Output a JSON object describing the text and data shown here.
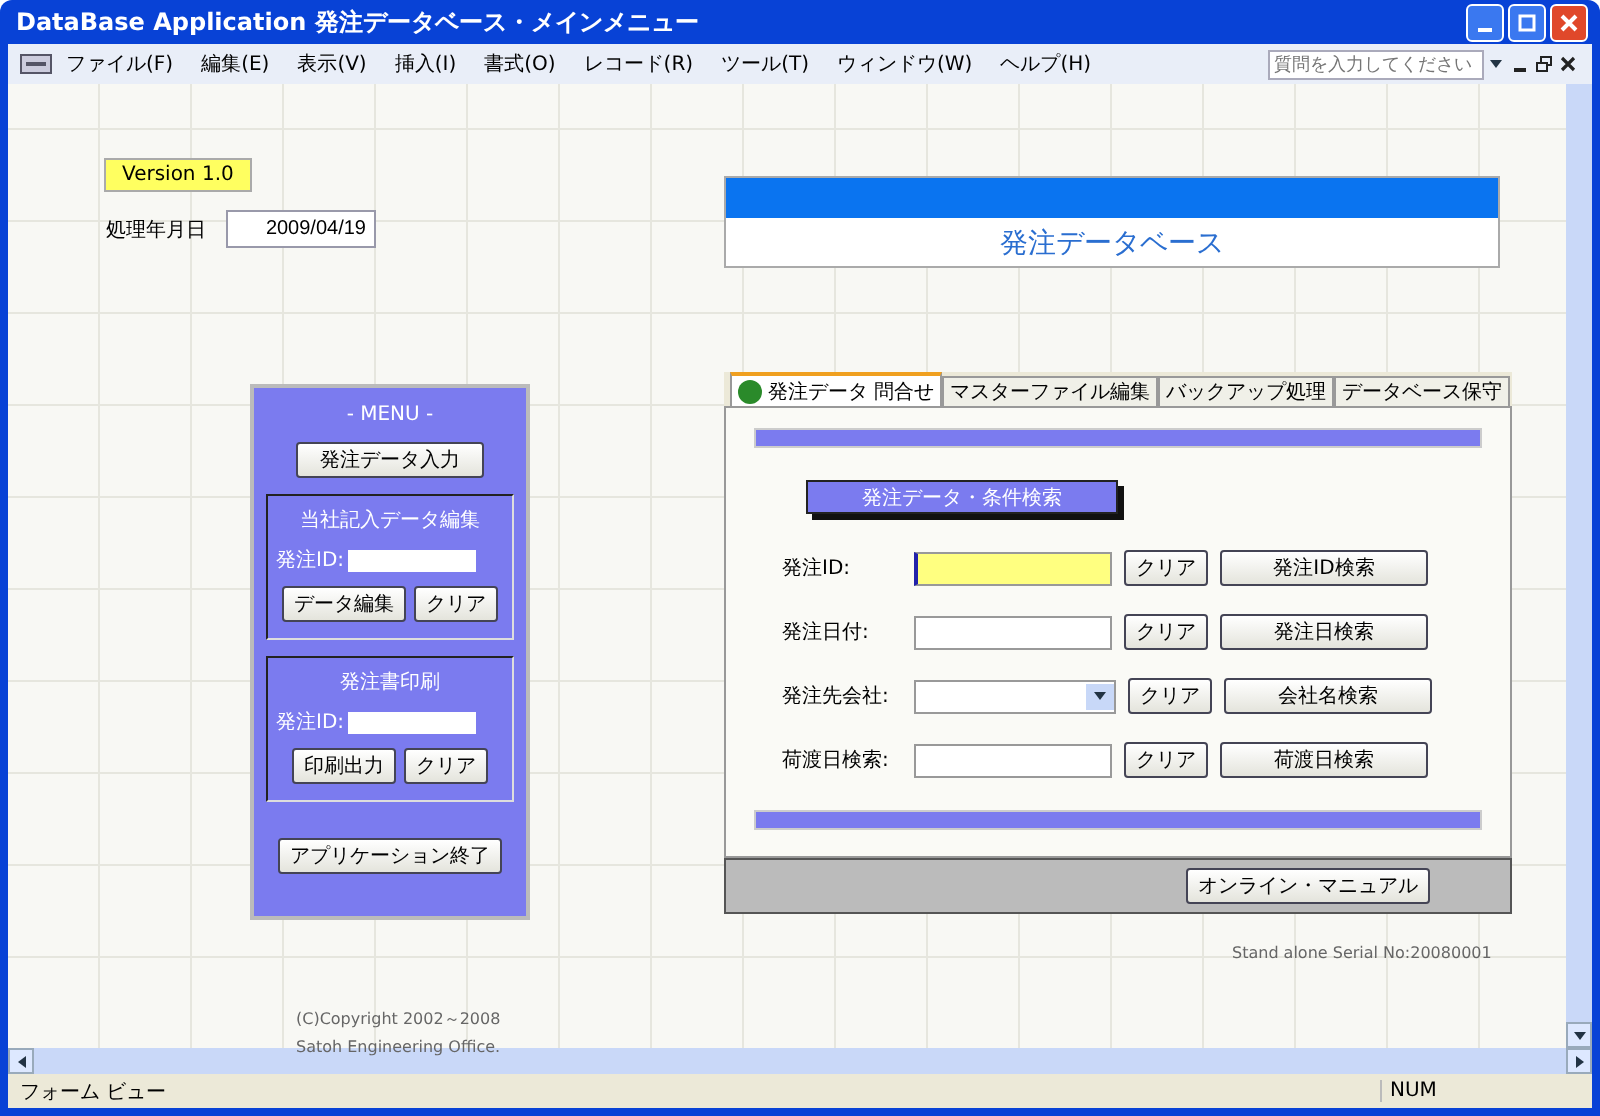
{
  "window": {
    "title": "DataBase  Application 発注データベース・メインメニュー"
  },
  "menu_bar": {
    "items": [
      "ファイル(F)",
      "編集(E)",
      "表示(V)",
      "挿入(I)",
      "書式(O)",
      "レコード(R)",
      "ツール(T)",
      "ウィンドウ(W)",
      "ヘルプ(H)"
    ],
    "help_search": {
      "placeholder": "質問を入力してください"
    }
  },
  "form": {
    "version": "Version 1.0",
    "date_label": "処理年月日",
    "date_value": "2009/04/19",
    "banner_title": "発注データベース",
    "menu_panel": {
      "heading": "- MENU -",
      "entry_button": "発注データ入力",
      "groups": [
        {
          "title": "当社記入データ編集",
          "id_label": "発注ID:",
          "action_button": "データ編集",
          "clear_button": "クリア"
        },
        {
          "title": "発注書印刷",
          "id_label": "発注ID:",
          "action_button": "印刷出力",
          "clear_button": "クリア"
        }
      ],
      "exit_button": "アプリケーション終了"
    },
    "tabs": [
      {
        "label": "発注データ 問合せ",
        "selected": true
      },
      {
        "label": "マスターファイル編集",
        "selected": false
      },
      {
        "label": "バックアップ処理",
        "selected": false
      },
      {
        "label": "データベース保守",
        "selected": false
      }
    ],
    "search_heading": "発注データ・条件検索",
    "search_rows": [
      {
        "kind": "text",
        "label": "発注ID:",
        "focused": true,
        "clear_button": "クリア",
        "search_button": "発注ID検索"
      },
      {
        "kind": "text",
        "label": "発注日付:",
        "focused": false,
        "clear_button": "クリア",
        "search_button": "発注日検索"
      },
      {
        "kind": "dropdown",
        "label": "発注先会社:",
        "focused": false,
        "clear_button": "クリア",
        "search_button": "会社名検索"
      },
      {
        "kind": "text",
        "label": "荷渡日検索:",
        "focused": false,
        "clear_button": "クリア",
        "search_button": "荷渡日検索"
      }
    ],
    "manual_button": "オンライン・マニュアル",
    "serial": "Stand alone Serial No:20080001",
    "copyright": [
      "(C)Copyright 2002～2008",
      "Satoh Engineering Office."
    ]
  },
  "status_bar": {
    "mode": "フォーム ビュー",
    "indicator": "NUM"
  }
}
